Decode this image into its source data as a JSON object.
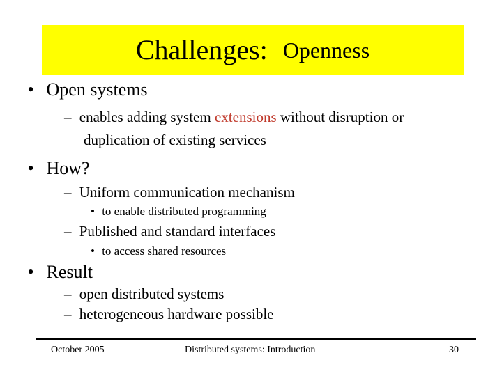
{
  "slide": {
    "title": "Challenges:",
    "subtitle": "Openness",
    "title_bg_color": "#ffff00",
    "accent_color": "#c0392b"
  },
  "content": {
    "b1": {
      "bullet": "•",
      "text": "Open systems"
    },
    "b1_1": {
      "dash": "–",
      "before": "enables adding system ",
      "highlight": "extensions",
      "after": " without disruption or",
      "line2": "duplication of existing services"
    },
    "b2": {
      "bullet": "•",
      "text": "How?"
    },
    "b2_1": {
      "dash": "–",
      "text": "Uniform communication mechanism"
    },
    "b2_1_1": {
      "bullet": "•",
      "text": "to enable distributed programming"
    },
    "b2_2": {
      "dash": "–",
      "text": "Published and standard interfaces"
    },
    "b2_2_1": {
      "bullet": "•",
      "text": "to access shared resources"
    },
    "b3": {
      "bullet": "•",
      "text": "Result"
    },
    "b3_1": {
      "dash": "–",
      "text": "open distributed systems"
    },
    "b3_2": {
      "dash": "–",
      "text": "heterogeneous hardware possible"
    }
  },
  "footer": {
    "date": "October 2005",
    "course": "Distributed systems: Introduction",
    "page": "30"
  }
}
